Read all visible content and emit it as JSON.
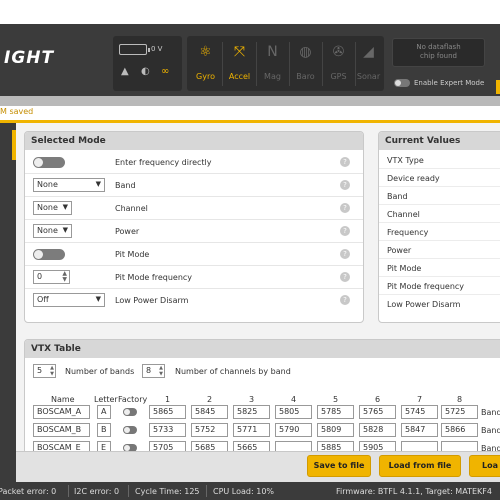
{
  "header": {
    "logo_text": "IGHT",
    "voltage": "0 V",
    "sensors": [
      {
        "name": "Gyro",
        "symbol": "⚛",
        "state": "on"
      },
      {
        "name": "Accel",
        "symbol": "⤧",
        "state": "on"
      },
      {
        "name": "Mag",
        "symbol": "N",
        "state": "off"
      },
      {
        "name": "Baro",
        "symbol": "◍",
        "state": "off"
      },
      {
        "name": "GPS",
        "symbol": "✇",
        "state": "off"
      },
      {
        "name": "Sonar",
        "symbol": "◢",
        "state": "off"
      }
    ],
    "dataflash_line1": "No dataflash",
    "dataflash_line2": "chip found",
    "expert_mode_label": "Enable Expert Mode",
    "accent_color": "#f0b400"
  },
  "status": {
    "message": "M saved"
  },
  "selected_mode": {
    "title": "Selected Mode",
    "rows": [
      {
        "label": "Enter frequency directly",
        "control": "toggle"
      },
      {
        "label": "Band",
        "control": "select",
        "value": "None"
      },
      {
        "label": "Channel",
        "control": "select",
        "value": "None"
      },
      {
        "label": "Power",
        "control": "select",
        "value": "None"
      },
      {
        "label": "Pit Mode",
        "control": "toggle"
      },
      {
        "label": "Pit Mode frequency",
        "control": "number",
        "value": "0"
      },
      {
        "label": "Low Power Disarm",
        "control": "select",
        "value": "Off"
      }
    ],
    "help_symbol": "?"
  },
  "current_values": {
    "title": "Current Values",
    "rows": [
      "VTX Type",
      "Device ready",
      "Band",
      "Channel",
      "Frequency",
      "Power",
      "Pit Mode",
      "Pit Mode frequency",
      "Low Power Disarm"
    ]
  },
  "vtx_table": {
    "title": "VTX Table",
    "number_of_bands": "5",
    "number_of_bands_label": "Number of bands",
    "number_of_channels": "8",
    "number_of_channels_label": "Number of channels by band",
    "headers": [
      "Name",
      "Letter",
      "Factory",
      "1",
      "2",
      "3",
      "4",
      "5",
      "6",
      "7",
      "8"
    ],
    "rows": [
      {
        "name": "BOSCAM_A",
        "letter": "A",
        "freqs": [
          "5865",
          "5845",
          "5825",
          "5805",
          "5785",
          "5765",
          "5745",
          "5725"
        ],
        "suffix": "Band"
      },
      {
        "name": "BOSCAM_B",
        "letter": "B",
        "freqs": [
          "5733",
          "5752",
          "5771",
          "5790",
          "5809",
          "5828",
          "5847",
          "5866"
        ],
        "suffix": "Band"
      },
      {
        "name": "BOSCAM_E",
        "letter": "E",
        "freqs": [
          "5705",
          "5685",
          "5665",
          "",
          "5885",
          "5905",
          "",
          ""
        ],
        "suffix": "Band"
      }
    ]
  },
  "actions": {
    "save_to_file": "Save to file",
    "load_from_file": "Load from file",
    "load_more": "Loa"
  },
  "footer": {
    "packet_error": "Packet error: 0",
    "i2c_error": "I2C error: 0",
    "cycle_time": "Cycle Time: 125",
    "cpu_load": "CPU Load: 10%",
    "firmware": "Firmware: BTFL 4.1.1, Target: MATEKF4"
  }
}
